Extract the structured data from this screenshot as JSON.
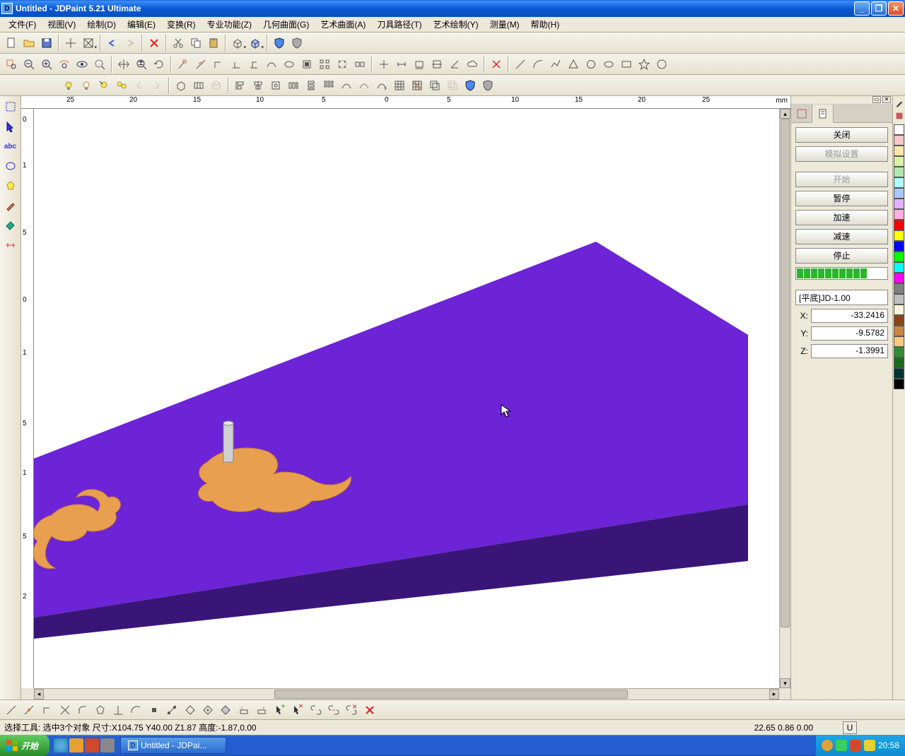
{
  "title": "Untitled - JDPaint 5.21 Ultimate",
  "menu": {
    "file": "文件(F)",
    "view": "视图(V)",
    "draw": "绘制(D)",
    "edit": "编辑(E)",
    "transform": "变换(R)",
    "pro": "专业功能(Z)",
    "geom": "几何曲面(G)",
    "art_surface": "艺术曲面(A)",
    "toolpath": "刀具路径(T)",
    "art_draw": "艺术绘制(Y)",
    "measure": "测量(M)",
    "help": "帮助(H)"
  },
  "ruler_unit": "mm",
  "ruler_h_ticks": [
    "25",
    "20",
    "15",
    "10",
    "5",
    "0",
    "5",
    "10",
    "15",
    "20",
    "25"
  ],
  "ruler_v_ticks": [
    "0",
    "1",
    "5",
    "0",
    "1",
    "5",
    "1",
    "5",
    "2"
  ],
  "panel": {
    "close": "关闭",
    "sim_settings": "模拟设置",
    "start": "开始",
    "pause": "暂停",
    "speedup": "加速",
    "slowdown": "减速",
    "stop": "停止",
    "tool": "[平底]JD-1.00",
    "x_label": "X:",
    "x_val": "-33.2416",
    "y_label": "Y:",
    "y_val": "-9.5782",
    "z_label": "Z:",
    "z_val": "-1.3991"
  },
  "status": {
    "left": "选择工具: 选中3个对象 尺寸:X104.75 Y40.00 Z1.87 高度:-1.87,0.00",
    "coords": "22.65 0.86 0.00",
    "u": "U"
  },
  "taskbar": {
    "start": "开始",
    "task1": "Untitled - JDPai...",
    "clock": "20:58"
  },
  "colors": [
    "#fff",
    "#f7c7c7",
    "#ffe6a8",
    "#d8f0a8",
    "#b0e8b0",
    "#a8ffff",
    "#a8c8ff",
    "#e0b0ff",
    "#ffb0e0",
    "#ff0000",
    "#ffff00",
    "#0000ff",
    "#00ff00",
    "#00ffff",
    "#ff00ff",
    "#808080",
    "#c0c0c0",
    "#f5f5dc",
    "#8b4513",
    "#cd853f",
    "#ffc880",
    "#2f8f2f",
    "#1a6a1a",
    "#003333",
    "#000000"
  ]
}
